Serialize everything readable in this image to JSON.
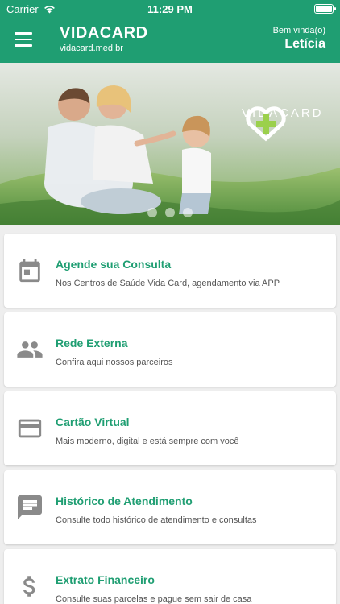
{
  "status": {
    "carrier": "Carrier",
    "time": "11:29 PM"
  },
  "header": {
    "brand": "VIDACARD",
    "site": "vidacard.med.br",
    "welcome": "Bem vinda(o)",
    "user": "Letícia"
  },
  "banner": {
    "logo_text": "VIDACARD",
    "slides": 3,
    "active_slide": 0
  },
  "menu": [
    {
      "icon": "calendar-icon",
      "title": "Agende sua Consulta",
      "desc": "Nos Centros de Saúde Vida Card, agendamento via APP"
    },
    {
      "icon": "people-icon",
      "title": "Rede Externa",
      "desc": "Confira aqui nossos parceiros"
    },
    {
      "icon": "credit-card-icon",
      "title": "Cartão Virtual",
      "desc": "Mais moderno, digital e está sempre com você"
    },
    {
      "icon": "chat-icon",
      "title": "Histórico de Atendimento",
      "desc": "Consulte todo histórico de atendimento e consultas"
    },
    {
      "icon": "dollar-icon",
      "title": "Extrato Financeiro",
      "desc": "Consulte suas parcelas e pague sem sair de casa"
    }
  ],
  "colors": {
    "primary": "#1f9e72",
    "icon": "#8a8a8a",
    "background": "#eeeeee"
  }
}
